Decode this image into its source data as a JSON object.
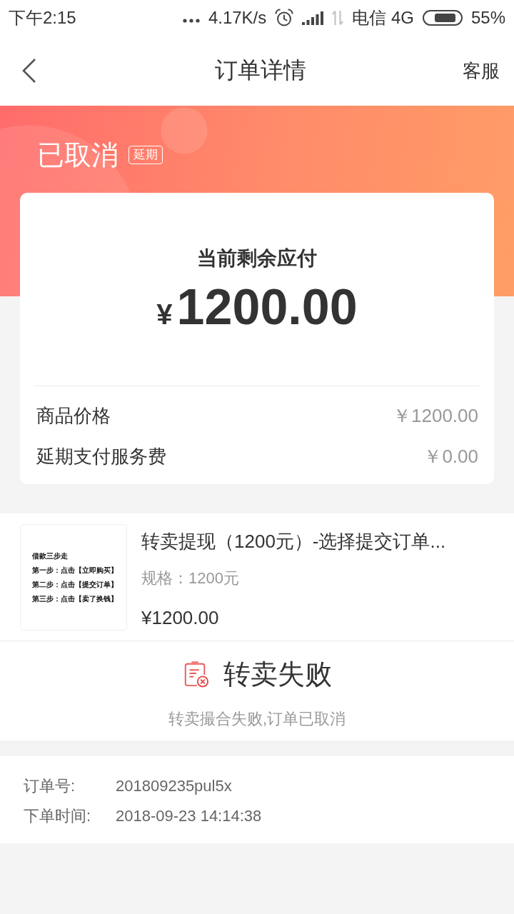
{
  "status_bar": {
    "time": "下午2:15",
    "network_speed": "4.17K/s",
    "carrier": "电信 4G",
    "battery": "55%"
  },
  "nav_bar": {
    "title": "订单详情",
    "action": "客服"
  },
  "order_status": {
    "title": "已取消",
    "tag": "延期"
  },
  "payment_card": {
    "label": "当前剩余应付",
    "currency": "¥",
    "amount": "1200.00",
    "rows": [
      {
        "label": "商品价格",
        "value": "￥1200.00"
      },
      {
        "label": "延期支付服务费",
        "value": "￥0.00"
      }
    ]
  },
  "product": {
    "thumbnail_text": [
      "借款三步走",
      "第一步：点击【立即购买】",
      "第二步：点击【提交订单】",
      "第三步：点击【卖了换钱】"
    ],
    "title": "转卖提现（1200元）-选择提交订单...",
    "spec": "规格：1200元",
    "price": "¥1200.00"
  },
  "resale_result": {
    "title": "转卖失败",
    "message": "转卖撮合失败,订单已取消"
  },
  "order_info": [
    {
      "label": "订单号:",
      "value": "201809235pul5x"
    },
    {
      "label": "下单时间:",
      "value": "2018-09-23 14:14:38"
    }
  ]
}
